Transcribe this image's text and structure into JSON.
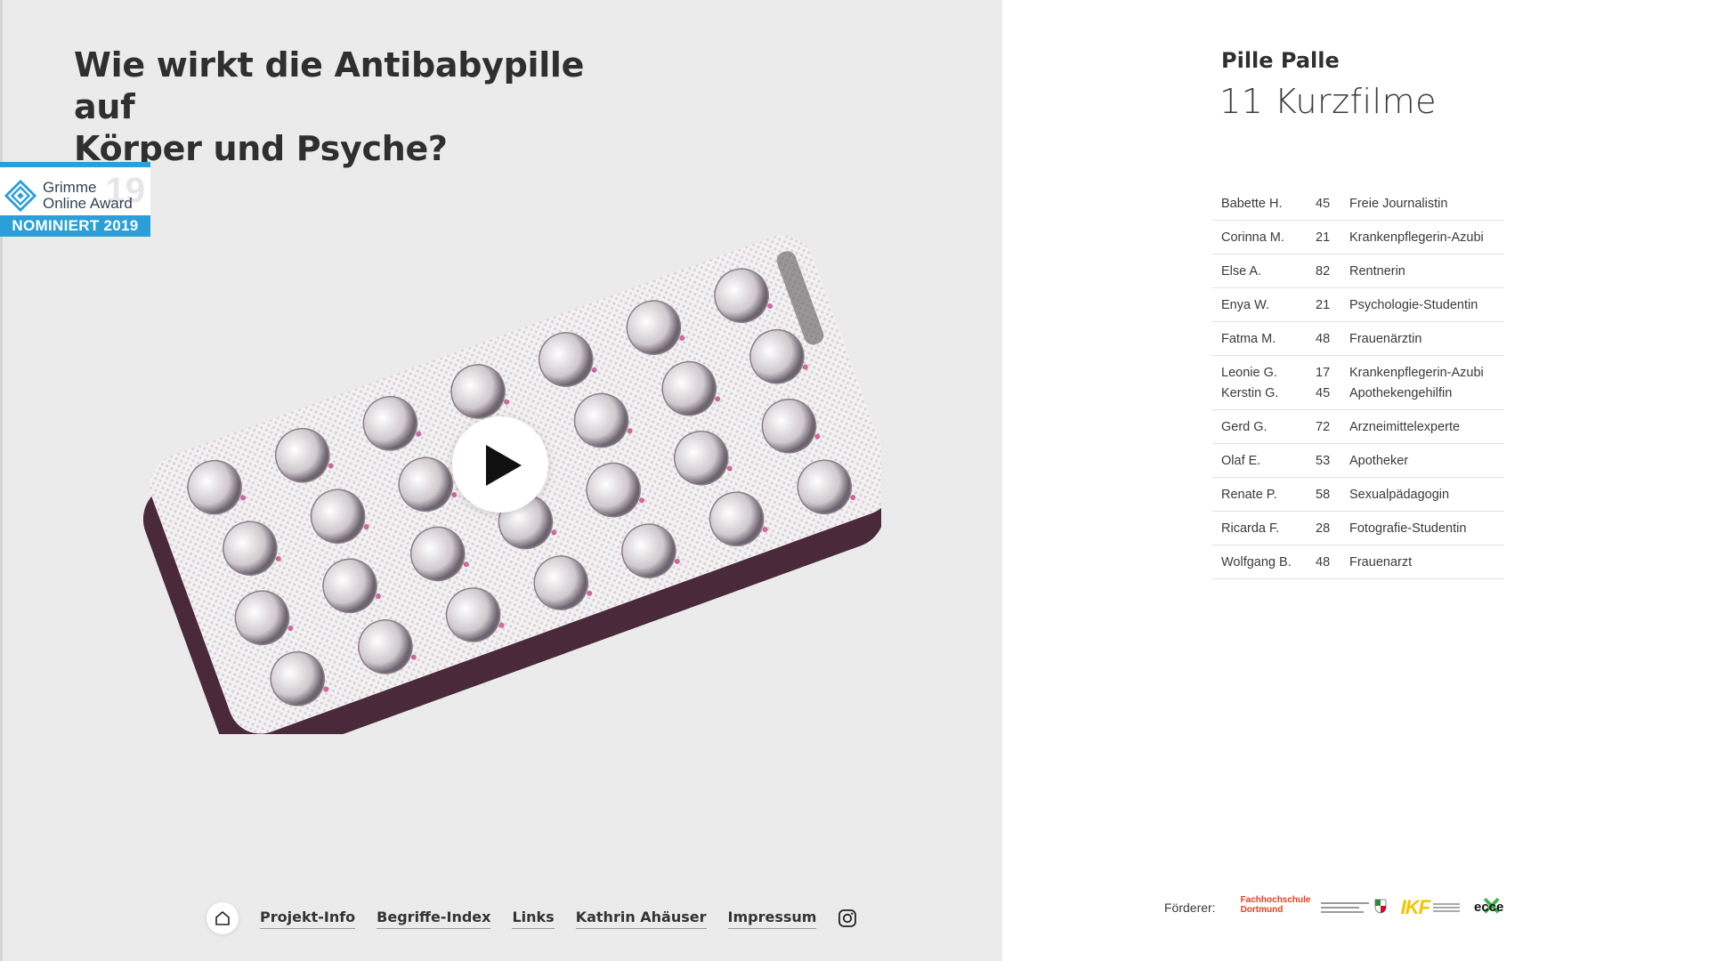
{
  "headline": {
    "line1": "Wie wirkt die Antibabypille auf",
    "line2": "Körper und Psyche?"
  },
  "award": {
    "name_line1": "Grimme",
    "name_line2": "Online Award",
    "badge": "NOMINIERT 2019",
    "watermark": "19"
  },
  "video": {
    "play_icon": "play-icon"
  },
  "nav": {
    "home_icon": "home-icon",
    "links": [
      "Projekt-Info",
      "Begriffe-Index",
      "Links",
      "Kathrin Ahäuser",
      "Impressum"
    ],
    "instagram_icon": "instagram-icon"
  },
  "series": {
    "title": "Pille Palle",
    "subtitle": "11 Kurzfilme"
  },
  "films": [
    {
      "people": [
        {
          "name": "Babette H.",
          "age": "45",
          "job": "Freie Journalistin"
        }
      ]
    },
    {
      "people": [
        {
          "name": "Corinna M.",
          "age": "21",
          "job": "Krankenpflegerin-Azubi"
        }
      ]
    },
    {
      "people": [
        {
          "name": "Else A.",
          "age": "82",
          "job": "Rentnerin"
        }
      ]
    },
    {
      "people": [
        {
          "name": "Enya W.",
          "age": "21",
          "job": "Psychologie-Studentin"
        }
      ]
    },
    {
      "people": [
        {
          "name": "Fatma M.",
          "age": "48",
          "job": "Frauenärztin"
        }
      ]
    },
    {
      "people": [
        {
          "name": "Leonie G.",
          "age": "17",
          "job": "Krankenpflegerin-Azubi"
        },
        {
          "name": "Kerstin G.",
          "age": "45",
          "job": "Apothekengehilfin"
        }
      ]
    },
    {
      "people": [
        {
          "name": "Gerd G.",
          "age": "72",
          "job": "Arzneimittelexperte"
        }
      ]
    },
    {
      "people": [
        {
          "name": "Olaf E.",
          "age": "53",
          "job": "Apotheker"
        }
      ]
    },
    {
      "people": [
        {
          "name": "Renate P.",
          "age": "58",
          "job": "Sexualpädagogin"
        }
      ]
    },
    {
      "people": [
        {
          "name": "Ricarda F.",
          "age": "28",
          "job": "Fotografie-Studentin"
        }
      ]
    },
    {
      "people": [
        {
          "name": "Wolfgang B.",
          "age": "48",
          "job": "Frauenarzt"
        }
      ]
    }
  ],
  "sponsors": {
    "label": "Förderer:",
    "fh_line1": "Fachhochschule",
    "fh_line2": "Dortmund",
    "ikf": "IKF",
    "ecce": "ecce"
  },
  "colors": {
    "left_bg": "#ebebeb",
    "award_blue": "#2a9fd8",
    "pack_dark": "#4a2a3a",
    "pill_magenta": "#c0307a"
  }
}
